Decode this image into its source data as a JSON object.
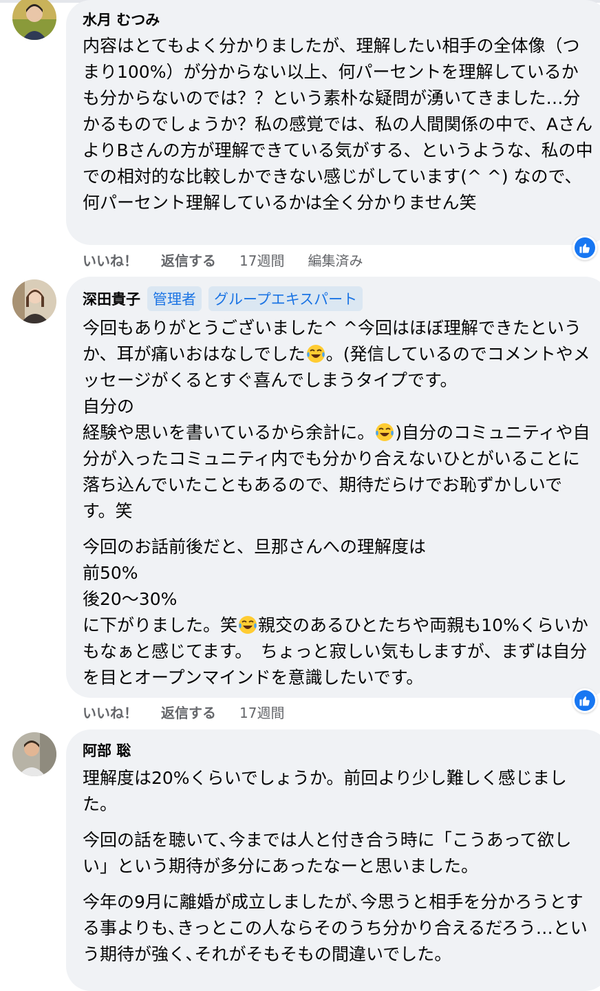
{
  "comments": [
    {
      "author": "水月 むつみ",
      "badges": [],
      "paragraphs": [
        "内容はとてもよく分かりましたが、理解したい相手の全体像（つまり100%）が分からない以上、何パーセントを理解しているかも分からないのでは？？という素朴な疑問が湧いてきました…分かるものでしょうか？私の感覚では、私の人間関係の中で、AさんよりBさんの方が理解できている気がする、というような、私の中での相対的な比較しかできない感じがしています(^ ^) なので、何パーセント理解しているかは全く分かりません笑"
      ],
      "actions": {
        "like": "いいね！",
        "reply": "返信する",
        "time": "17週間",
        "edited": "編集済み"
      }
    },
    {
      "author": "深田貴子",
      "badges": [
        "管理者",
        "グループエキスパート"
      ],
      "p1_a": "今回もありがとうございました^ ^今回はほぼ理解できたというか、耳が痛いおはなしでした",
      "p1_b": "。(発信しているのでコメントやメッセージがくるとすぐ喜んでしまうタイプです。",
      "p1_c": "自分の",
      "p1_d": "経験や思いを書いているから余計に。",
      "p1_e": ")自分のコミュニティや自分が入ったコミュニティ内でも分かり合えないひとがいることに落ち込んでいたこともあるので、期待だらけでお恥ずかしいです。笑",
      "p2_a": "今回のお話前後だと、旦那さんへの理解度は",
      "p2_b": "前50%",
      "p2_c": "後20〜30%",
      "p2_d": "に下がりました。笑",
      "p2_e": "親交のあるひとたちや両親も10%くらいかもなぁと感じてます。　ちょっと寂しい気もしますが、まずは自分を目とオープンマインドを意識したいです。",
      "actions": {
        "like": "いいね！",
        "reply": "返信する",
        "time": "17週間"
      }
    },
    {
      "author": "阿部 聡",
      "badges": [],
      "paragraphs": [
        "理解度は20%くらいでしょうか。前回より少し難しく感じました。",
        "今回の話を聴いて､今までは人と付き合う時に「こうあって欲しい」という期待が多分にあったなーと思いました。",
        "今年の9月に離婚が成立しましたが､今思うと相手を分かろうとする事よりも､きっとこの人ならそのうち分かり合えるだろう…という期待が強く､それがそもそもの間違いでした。"
      ]
    }
  ],
  "icons": {
    "like_reaction": "thumbs-up-icon",
    "emoji_laugh": "tears-of-joy-emoji"
  },
  "colors": {
    "bubble": "#f0f2f5",
    "badge_text": "#1b74e4",
    "badge_bg": "#dbe7f2",
    "meta_text": "#65676b",
    "like_blue": "#1877f2"
  }
}
